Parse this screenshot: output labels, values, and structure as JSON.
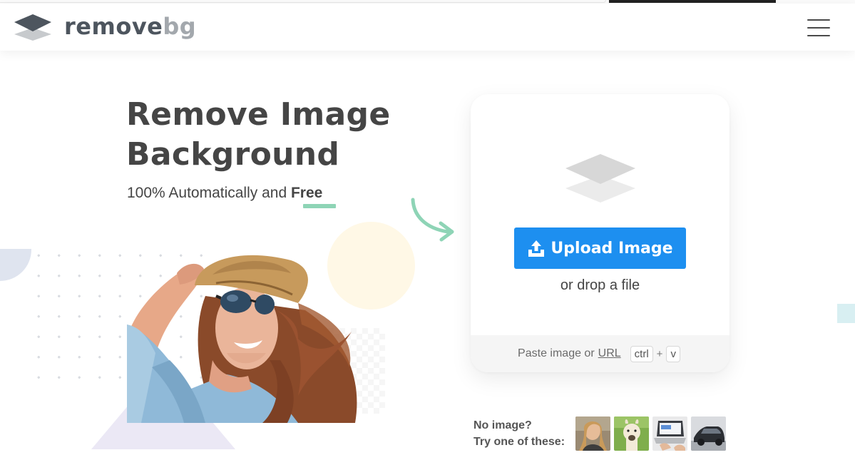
{
  "brand": {
    "name_part1": "remove",
    "name_part2": "bg"
  },
  "header": {
    "menu_icon": "hamburger-menu-icon"
  },
  "hero": {
    "title_line1": "Remove Image",
    "title_line2": "Background",
    "subtitle_prefix": "100% Automatically and ",
    "subtitle_free": "Free",
    "accent_color": "#8ed4b6"
  },
  "upload": {
    "button_label": "Upload Image",
    "button_color": "#1d8ff0",
    "drop_text": "or drop a file",
    "paste_prefix": "Paste image or",
    "paste_url": "URL",
    "key_ctrl": "ctrl",
    "key_plus": "+",
    "key_v": "v"
  },
  "samples": {
    "line1": "No image?",
    "line2": "Try one of these:",
    "items": [
      "woman-portrait",
      "alpaca",
      "laptop",
      "car"
    ]
  }
}
